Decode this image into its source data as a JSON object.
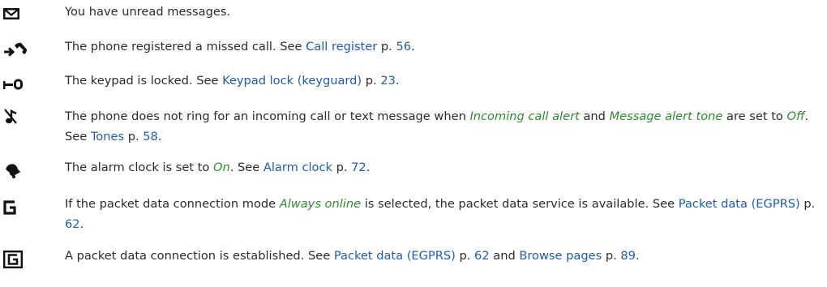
{
  "items": [
    {
      "icon": "envelope-icon",
      "p0": "You have unread messages."
    },
    {
      "icon": "missed-call-icon",
      "p0": "The phone registered a missed call. See ",
      "l0": "Call register",
      "p1": " p. ",
      "l1": "56",
      "p2": "."
    },
    {
      "icon": "key-lock-icon",
      "p0": "The keypad is locked. See ",
      "l0": "Keypad lock (keyguard)",
      "p1": " p. ",
      "l1": "23",
      "p2": "."
    },
    {
      "icon": "silent-note-icon",
      "p0": "The phone does not ring for an incoming call or text message when ",
      "i0": "Incoming call alert",
      "p1": " and ",
      "i1": "Message alert tone",
      "p2": " are set to ",
      "i2": "Off",
      "p3": ". See ",
      "l0": "Tones",
      "p4": " p. ",
      "l1": "58",
      "p5": "."
    },
    {
      "icon": "alarm-bell-icon",
      "p0": "The alarm clock is set to ",
      "i0": "On",
      "p1": ". See ",
      "l0": "Alarm clock",
      "p2": " p. ",
      "l1": "72",
      "p3": "."
    },
    {
      "icon": "gprs-g-icon",
      "p0": "If the packet data connection mode ",
      "i0": "Always online",
      "p1": " is selected, the packet data service is available. See ",
      "l0": "Packet data (EGPRS)",
      "p2": " p. ",
      "l1": "62",
      "p3": "."
    },
    {
      "icon": "gprs-boxed-g-icon",
      "p0": "A packet data connection is established. See ",
      "l0": "Packet data (EGPRS)",
      "p1": " p. ",
      "l1": "62",
      "p2": " and ",
      "l2": "Browse pages",
      "p3": " p. ",
      "l3": "89",
      "p4": "."
    }
  ]
}
